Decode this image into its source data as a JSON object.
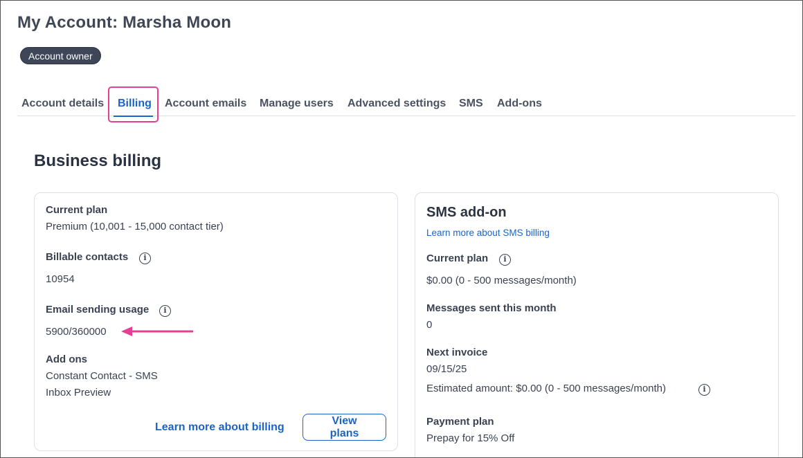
{
  "header": {
    "title": "My Account: Marsha Moon",
    "badge": "Account owner"
  },
  "tabs": [
    {
      "label": "Account details"
    },
    {
      "label": "Billing",
      "active": true
    },
    {
      "label": "Account emails"
    },
    {
      "label": "Manage users"
    },
    {
      "label": "Advanced settings"
    },
    {
      "label": "SMS"
    },
    {
      "label": "Add-ons"
    }
  ],
  "section_title": "Business billing",
  "billing_card": {
    "current_plan_label": "Current plan",
    "current_plan_value": "Premium (10,001 - 15,000 contact tier)",
    "billable_contacts_label": "Billable contacts",
    "billable_contacts_value": "10954",
    "email_usage_label": "Email sending usage",
    "email_usage_value": "5900/360000",
    "add_ons_label": "Add ons",
    "add_ons": [
      "Constant Contact - SMS",
      "Inbox Preview"
    ],
    "learn_more_link": "Learn more about billing",
    "view_plans_button": "View plans"
  },
  "sms_card": {
    "title": "SMS add-on",
    "learn_more_link": "Learn more about SMS billing",
    "current_plan_label": "Current plan",
    "current_plan_value": "$0.00 (0 - 500 messages/month)",
    "messages_sent_label": "Messages sent this month",
    "messages_sent_value": "0",
    "next_invoice_label": "Next invoice",
    "next_invoice_date": "09/15/25",
    "estimated_amount": "Estimated amount: $0.00 (0 - 500 messages/month)",
    "payment_plan_label": "Payment plan",
    "payment_plan_value": "Prepay for 15% Off"
  },
  "colors": {
    "accent": "#1b64c7",
    "highlight": "#e63e95",
    "badge_bg": "#3e4658"
  },
  "icons": [
    "info-icon",
    "arrow-left-icon"
  ]
}
